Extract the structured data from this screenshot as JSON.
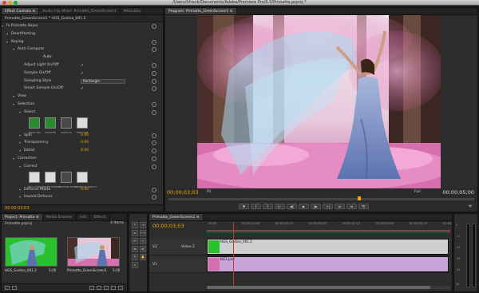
{
  "window": {
    "title": "/Users/hfrank/Documents/Adobe/Premiere Pro/6.0/Primatte.prproj *"
  },
  "effect_controls": {
    "tabs": [
      {
        "label": "Effect Controls ≡",
        "active": true
      },
      {
        "label": "Audio Clip Mixer: Primatte_GreenScreen1",
        "active": false
      },
      {
        "label": "Metadata",
        "active": false
      }
    ],
    "clip_path": "Primatte_GreenScreen1 * HGS_Godiva_001.2",
    "rows": [
      {
        "label": "fx  Primatte Keyer",
        "indent": 6,
        "tri": true,
        "reset": true,
        "control": null
      },
      {
        "label": "Deartifacting",
        "indent": 12,
        "tri": true,
        "reset": false,
        "control": null
      },
      {
        "label": "Keying",
        "indent": 12,
        "tri": true,
        "reset": true,
        "control": null
      },
      {
        "label": "Auto Compute",
        "indent": 20,
        "tri": true,
        "reset": true,
        "control": null
      },
      {
        "label": "",
        "indent": 0,
        "tri": false,
        "reset": false,
        "control": "auto"
      },
      {
        "label": "Adjust Light On/Off",
        "indent": 28,
        "tri": false,
        "reset": true,
        "control": "check"
      },
      {
        "label": "Sample On/Off",
        "indent": 28,
        "tri": false,
        "reset": true,
        "control": "check"
      },
      {
        "label": "Sampling Style",
        "indent": 28,
        "tri": false,
        "reset": true,
        "control": "drop"
      },
      {
        "label": "Smart Sample On/Off",
        "indent": 28,
        "tri": false,
        "reset": true,
        "control": "check"
      },
      {
        "label": "View",
        "indent": 20,
        "tri": true,
        "reset": false,
        "control": null
      },
      {
        "label": "Selection",
        "indent": 20,
        "tri": true,
        "reset": true,
        "control": null
      },
      {
        "label": "Select",
        "indent": 28,
        "tri": true,
        "reset": true,
        "control": null
      },
      {
        "label": "",
        "indent": 0,
        "tri": false,
        "reset": false,
        "control": "tools1"
      },
      {
        "label": "",
        "indent": 0,
        "tri": false,
        "reset": false,
        "control": "spacer"
      },
      {
        "label": "Spill",
        "indent": 28,
        "tri": true,
        "reset": true,
        "control": "val"
      },
      {
        "label": "Transparency",
        "indent": 28,
        "tri": true,
        "reset": true,
        "control": "val"
      },
      {
        "label": "Detail",
        "indent": 28,
        "tri": true,
        "reset": true,
        "control": "val"
      },
      {
        "label": "Correction",
        "indent": 20,
        "tri": true,
        "reset": true,
        "control": null
      },
      {
        "label": "Correct",
        "indent": 28,
        "tri": true,
        "reset": true,
        "control": null
      },
      {
        "label": "",
        "indent": 0,
        "tri": false,
        "reset": false,
        "control": "tools2"
      },
      {
        "label": "",
        "indent": 0,
        "tri": false,
        "reset": false,
        "control": "spacer"
      },
      {
        "label": "Defocus Matte",
        "indent": 28,
        "tri": true,
        "reset": true,
        "control": "val"
      },
      {
        "label": "Inward Defocus",
        "indent": 28,
        "tri": true,
        "reset": true,
        "control": null
      }
    ],
    "auto_label": "Auto",
    "sampling_style": "Rectangle",
    "value": "0.00",
    "tools_select": [
      "SELECT BG",
      "CLEAN BG",
      "CLEAN FG",
      "FINE TUNE"
    ],
    "tools_correct": [
      "SPILL SPONGE",
      "MATTE SPONGE",
      "RESTORE DETAIL",
      "DECREASE OPACITY"
    ],
    "timecode": "00;00;03;03"
  },
  "program_monitor": {
    "tabs": [
      {
        "label": "Program: Primatte_GreenScreen1 ≡",
        "active": true
      }
    ],
    "timecode_current": "00;00;03;03",
    "fit": "Fit",
    "quality": "Full",
    "timecode_duration": "00;00;05;00",
    "buttons": [
      "▼",
      "{",
      "}",
      "|←",
      "◀|",
      "▶",
      "|▶",
      "→|",
      "⇄",
      "⇆",
      "📷"
    ]
  },
  "project": {
    "tabs": [
      {
        "label": "Project: Primatte ≡",
        "active": true
      },
      {
        "label": "Media Browser",
        "active": false
      },
      {
        "label": "Info",
        "active": false
      },
      {
        "label": "Effects",
        "active": false
      }
    ],
    "filename": "Primatte.prproj",
    "count": "4 Items",
    "items": [
      {
        "name": "HGS_Godiva_001.2",
        "duration": "5;00"
      },
      {
        "name": "Primatte_GreenScreen1",
        "duration": "5;00"
      }
    ]
  },
  "timeline": {
    "tabs": [
      {
        "label": "Primatte_GreenScreen1 ≡",
        "active": true
      }
    ],
    "timecode": "00;00;03;03",
    "ruler_labels": [
      "00;00",
      "00;00;01;00",
      "00;00;01;15",
      "00;00;02;00",
      "00;00;02;15",
      "00;00;03;00",
      "00;00;03;15",
      "00;00;04;00"
    ],
    "tracks": [
      {
        "id": "V2",
        "name": "Video 2",
        "clip": "HGS_Godiva_001.2",
        "kind": "v2"
      },
      {
        "id": "V1",
        "name": "",
        "clip": "BG1.psd",
        "kind": "v1"
      }
    ]
  },
  "meters": {
    "labels": [
      "0",
      "-12",
      "-24",
      "-36",
      "-48",
      "dB"
    ]
  },
  "colors": {
    "accent": "#f0a600",
    "clip_video": "#cfcfcf",
    "clip_bg": "#c8a4d8",
    "panel": "#2d2d2d"
  }
}
